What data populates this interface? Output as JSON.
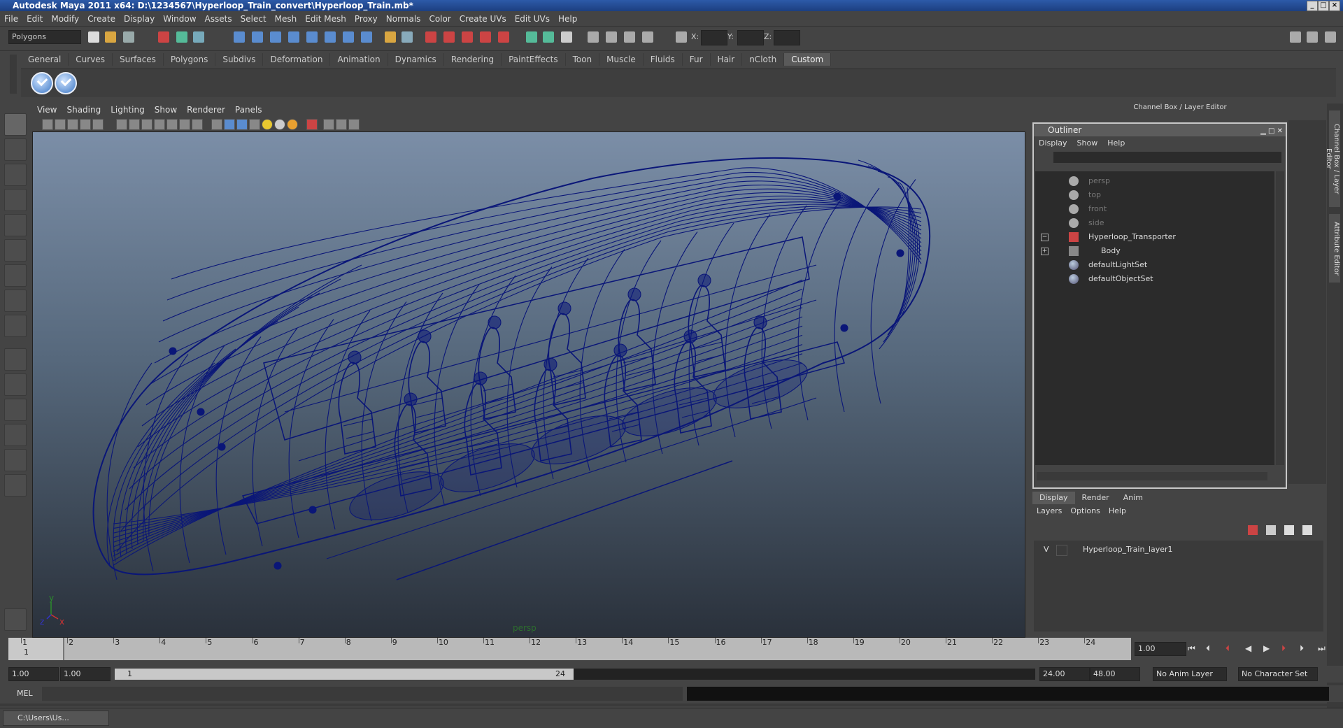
{
  "window": {
    "title": "Autodesk Maya 2011 x64: D:\\1234567\\Hyperloop_Train_convert\\Hyperloop_Train.mb*"
  },
  "menubar": [
    "File",
    "Edit",
    "Modify",
    "Create",
    "Display",
    "Window",
    "Assets",
    "Select",
    "Mesh",
    "Edit Mesh",
    "Proxy",
    "Normals",
    "Color",
    "Create UVs",
    "Edit UVs",
    "Help"
  ],
  "statusline": {
    "menuset": "Polygons",
    "x_label": "X:",
    "y_label": "Y:",
    "z_label": "Z:"
  },
  "shelf": {
    "tabs": [
      "General",
      "Curves",
      "Surfaces",
      "Polygons",
      "Subdivs",
      "Deformation",
      "Animation",
      "Dynamics",
      "Rendering",
      "PaintEffects",
      "Toon",
      "Muscle",
      "Fluids",
      "Fur",
      "Hair",
      "nCloth",
      "Custom"
    ],
    "active_tab": "Custom"
  },
  "viewport": {
    "menu": [
      "View",
      "Shading",
      "Lighting",
      "Show",
      "Renderer",
      "Panels"
    ],
    "camera_label": "persp",
    "axis_y": "y",
    "axis_x": "x",
    "axis_z": "z",
    "wire_color": "#0a1678"
  },
  "channelbox": {
    "header": "Channel Box / Layer Editor",
    "side_tab_1": "Channel Box / Layer Editor",
    "side_tab_2": "Attribute Editor"
  },
  "outliner": {
    "title": "Outliner",
    "menu": [
      "Display",
      "Show",
      "Help"
    ],
    "items": [
      {
        "label": "persp",
        "dim": true
      },
      {
        "label": "top",
        "dim": true
      },
      {
        "label": "front",
        "dim": true
      },
      {
        "label": "side",
        "dim": true
      },
      {
        "label": "Hyperloop_Transporter",
        "dim": false
      },
      {
        "label": "Body",
        "dim": false
      },
      {
        "label": "defaultLightSet",
        "dim": false
      },
      {
        "label": "defaultObjectSet",
        "dim": false
      }
    ]
  },
  "layers": {
    "tabs": [
      "Display",
      "Render",
      "Anim"
    ],
    "active_tab": "Display",
    "menu": [
      "Layers",
      "Options",
      "Help"
    ],
    "rows": [
      {
        "visible": "V",
        "name": "Hyperloop_Train_layer1"
      }
    ]
  },
  "timeline": {
    "frames": [
      "1",
      "2",
      "3",
      "4",
      "5",
      "6",
      "7",
      "8",
      "9",
      "10",
      "11",
      "12",
      "13",
      "14",
      "15",
      "16",
      "17",
      "18",
      "19",
      "20",
      "21",
      "22",
      "23",
      "24"
    ],
    "current_frame_label": "1",
    "current_time": "1.00"
  },
  "range": {
    "start": "1.00",
    "playback_start": "1.00",
    "slider_start": "1",
    "slider_end": "24",
    "playback_end": "24.00",
    "end": "48.00",
    "anim_layer": "No Anim Layer",
    "character_set": "No Character Set"
  },
  "command": {
    "label": "MEL"
  },
  "taskbar": {
    "label": "C:\\Users\\Us..."
  }
}
